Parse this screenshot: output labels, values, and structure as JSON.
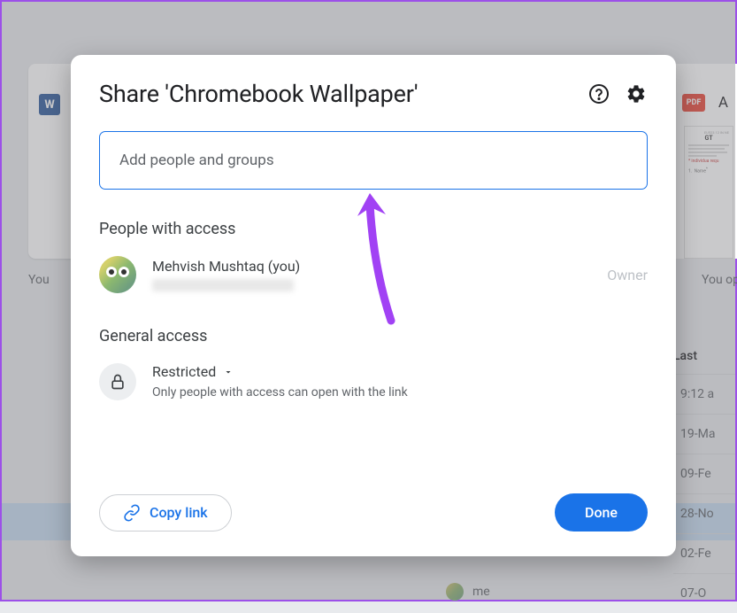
{
  "modal": {
    "title": "Share 'Chromebook Wallpaper'",
    "input_placeholder": "Add people and groups",
    "people_section_title": "People with access",
    "person": {
      "name": "Mehvish Mushtaq (you)",
      "role": "Owner"
    },
    "general_access_title": "General access",
    "access_type": "Restricted",
    "access_desc": "Only people with access can open with the link",
    "copy_link_label": "Copy link",
    "done_label": "Done"
  },
  "background": {
    "word_badge": "W",
    "pdf_badge": "PDF",
    "a_label": "A",
    "you_label": "You",
    "you_opened": "You op",
    "doc_title": "GT",
    "list_header": "Last",
    "list_items": [
      "9:12 a",
      "19-Ma",
      "09-Fe",
      "28-No",
      "02-Fe",
      "07-O"
    ],
    "me_label": "me"
  }
}
